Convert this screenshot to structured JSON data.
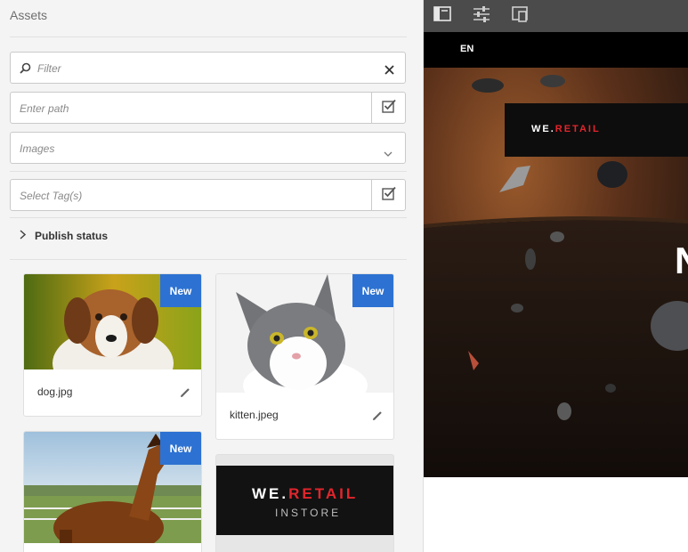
{
  "panel": {
    "title": "Assets",
    "filter_placeholder": "Filter",
    "path_placeholder": "Enter path",
    "type_select": "Images",
    "tags_placeholder": "Select Tag(s)",
    "publish_status": "Publish status"
  },
  "cards": [
    {
      "name": "dog.jpg",
      "badge": "New",
      "thumb": "dog"
    },
    {
      "name": "kitten.jpeg",
      "badge": "New",
      "thumb": "kitten"
    },
    {
      "name": "",
      "badge": "New",
      "thumb": "horse"
    },
    {
      "name": "",
      "badge": "",
      "thumb": "we-retail-instore",
      "brand_we": "WE.",
      "brand_retail": "RETAIL",
      "brand_sub": "INSTORE"
    }
  ],
  "preview": {
    "lang": "EN",
    "brand_we": "WE.",
    "brand_retail": "RETAIL",
    "hero_letter": "N"
  },
  "colors": {
    "badge_blue": "#2d72d2",
    "brand_red": "#e3252c",
    "toolbar": "#4b4b4b"
  }
}
